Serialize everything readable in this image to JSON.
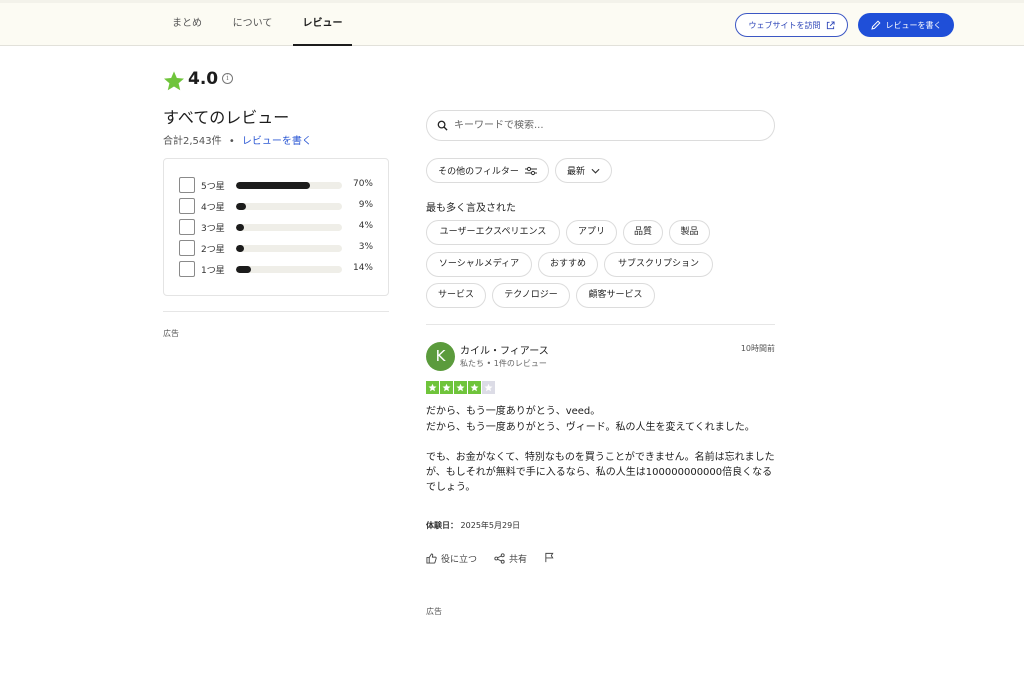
{
  "nav": {
    "tabs": [
      {
        "label": "まとめ"
      },
      {
        "label": "について"
      },
      {
        "label": "レビュー"
      }
    ],
    "visit_website_label": "ウェブサイトを訪問",
    "write_review_label": "レビューを書く"
  },
  "summary": {
    "rating": "4.0",
    "info_icon_glyph": "i",
    "all_reviews_title": "すべてのレビュー",
    "total_text": "合計2,543件",
    "separator": "•",
    "write_review_link": "レビューを書く"
  },
  "distribution": [
    {
      "label": "5つ星",
      "percent": 70,
      "percent_label": "70%"
    },
    {
      "label": "4つ星",
      "percent": 9,
      "percent_label": "9%"
    },
    {
      "label": "3つ星",
      "percent": 4,
      "percent_label": "4%"
    },
    {
      "label": "2つ星",
      "percent": 3,
      "percent_label": "3%"
    },
    {
      "label": "1つ星",
      "percent": 14,
      "percent_label": "14%"
    }
  ],
  "ad_label": "広告",
  "search": {
    "placeholder": "キーワードで検索..."
  },
  "filters": {
    "more_filters_label": "その他のフィルター",
    "sort_label": "最新"
  },
  "mentioned": {
    "title": "最も多く言及された",
    "chips": [
      "ユーザーエクスペリエンス",
      "アプリ",
      "品質",
      "製品",
      "ソーシャルメディア",
      "おすすめ",
      "サブスクリプション",
      "サービス",
      "テクノロジー",
      "顧客サービス"
    ]
  },
  "review": {
    "avatar_initial": "K",
    "avatar_color": "#5b9b3c",
    "reviewer_name": "カイル・フィアース",
    "reviewer_meta": "私たち • 1件のレビュー",
    "time_ago": "10時間前",
    "stars": 4,
    "max_stars": 5,
    "title": "だから、もう一度ありがとう、veed。",
    "body": "だから、もう一度ありがとう、ヴィード。私の人生を変えてくれました。\n\nでも、お金がなくて、特別なものを買うことができません。名前は忘れましたが、もしそれが無料で手に入るなら、私の人生は100000000000倍良くなるでしょう。",
    "experience_label": "体験日：",
    "experience_date": "2025年5月29日",
    "actions": {
      "helpful_label": "役に立つ",
      "share_label": "共有"
    }
  },
  "colors": {
    "accent_blue": "#1f4fd8",
    "star_green": "#6fc43b"
  }
}
